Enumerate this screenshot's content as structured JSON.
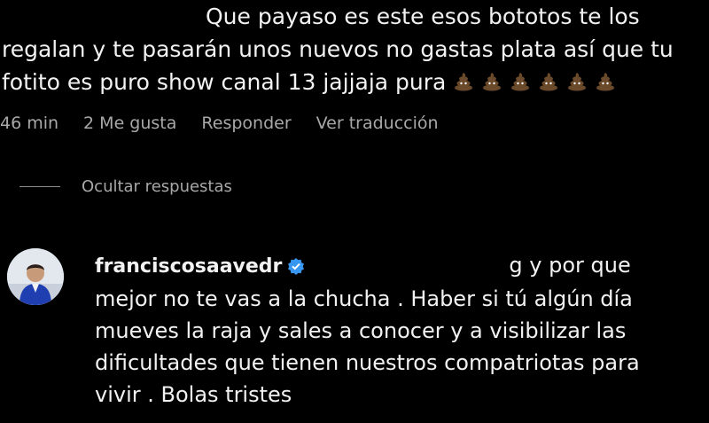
{
  "comment": {
    "lines": [
      "Que payaso es este esos bototos te los",
      "regalan y te pasarán unos nuevos no gastas plata así que tu",
      "fotito es puro show canal 13 jajjaja pura"
    ],
    "emoji_name": "poop-emoji",
    "emoji_count": 6
  },
  "meta": {
    "time": "46 min",
    "likes": "2 Me gusta",
    "reply": "Responder",
    "translate": "Ver traducción"
  },
  "hide_replies": "Ocultar respuestas",
  "reply": {
    "username": "franciscosaavedr",
    "verified_icon": "verified-badge-icon",
    "first_line_tail": "g y por que",
    "lines": [
      "mejor no te vas a la chucha . Haber si tú algún día",
      "mueves la raja y sales a conocer y a visibilizar las",
      "dificultades que tienen nuestros compatriotas para",
      "vivir . Bolas tristes"
    ]
  },
  "colors": {
    "background": "#000000",
    "text": "#f2f2f2",
    "meta_text": "#a8a8a8",
    "verified_blue": "#3897f0",
    "emoji_brown": "#6b4a2b"
  }
}
